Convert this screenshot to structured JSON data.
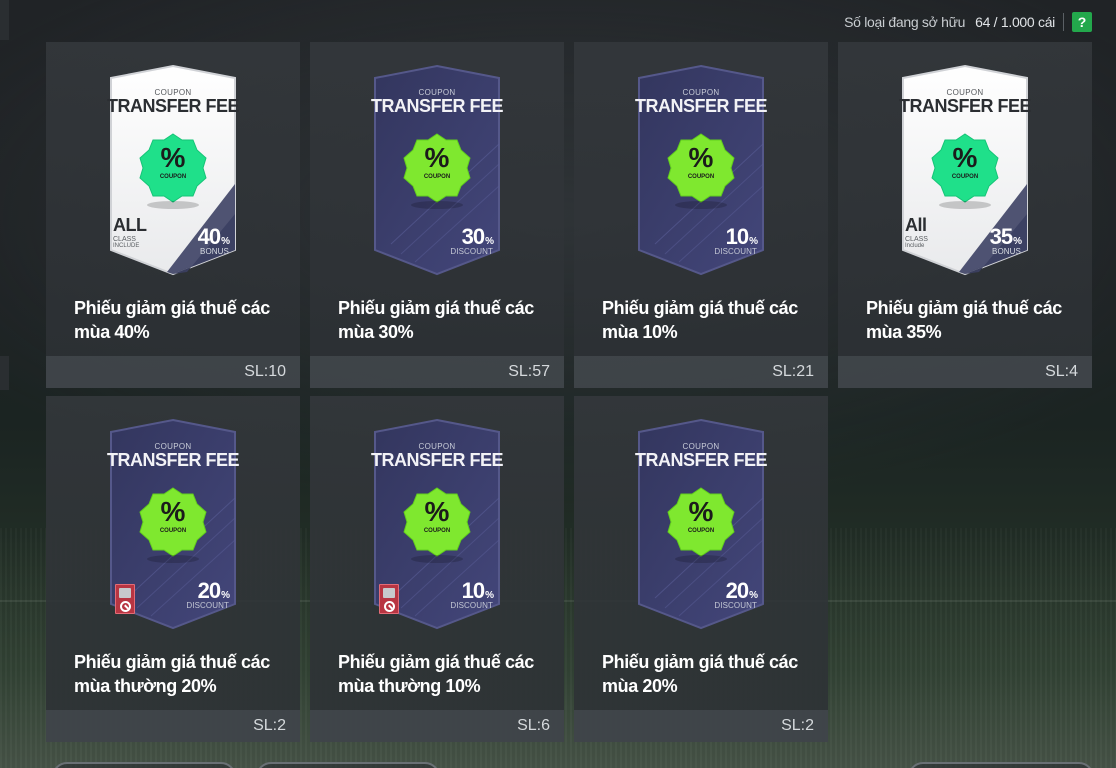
{
  "header": {
    "inventory_label": "Số loại đang sở hữu",
    "inventory_count": "64 / 1.000 cái",
    "help_label": "?"
  },
  "coupon_common": {
    "small": "COUPON",
    "big": "TRANSFER FEE",
    "badge_small": "COUPON"
  },
  "items": [
    {
      "name": "Phiếu giảm giá thuế các mùa 40%",
      "qty": "SL:10",
      "value": "40",
      "unit": "%",
      "sub": "BONUS",
      "style": "light",
      "class_a": "ALL",
      "class_b": "CLASS",
      "class_c": "INCLUDE"
    },
    {
      "name": "Phiếu giảm giá thuế các mùa 30%",
      "qty": "SL:57",
      "value": "30",
      "unit": "%",
      "sub": "DISCOUNT",
      "style": "dark"
    },
    {
      "name": "Phiếu giảm giá thuế các mùa 10%",
      "qty": "SL:21",
      "value": "10",
      "unit": "%",
      "sub": "DISCOUNT",
      "style": "dark"
    },
    {
      "name": "Phiếu giảm giá thuế các mùa 35%",
      "qty": "SL:4",
      "value": "35",
      "unit": "%",
      "sub": "BONUS",
      "style": "light",
      "class_a": "All",
      "class_b": "CLASS",
      "class_c": "Include"
    },
    {
      "name": "Phiếu giảm giá thuế các mùa thường 20%",
      "qty": "SL:2",
      "value": "20",
      "unit": "%",
      "sub": "DISCOUNT",
      "style": "dark",
      "restricted": true
    },
    {
      "name": "Phiếu giảm giá thuế các mùa thường 10%",
      "qty": "SL:6",
      "value": "10",
      "unit": "%",
      "sub": "DISCOUNT",
      "style": "dark",
      "restricted": true
    },
    {
      "name": "Phiếu giảm giá thuế các mùa 20%",
      "qty": "SL:2",
      "value": "20",
      "unit": "%",
      "sub": "DISCOUNT",
      "style": "dark"
    }
  ],
  "colors": {
    "help_green": "#23a84c",
    "badge_green": "#7fe82f",
    "badge_mint": "#1fe08a",
    "coupon_dark": "#3a3d68",
    "coupon_light": "#f4f4f4"
  }
}
